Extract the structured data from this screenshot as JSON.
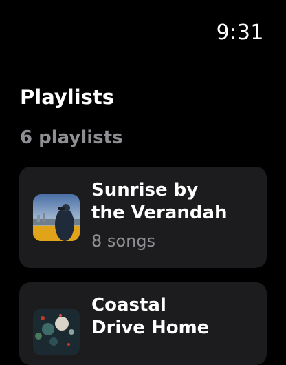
{
  "status_bar": {
    "time": "9:31"
  },
  "header": {
    "title": "Playlists",
    "count": "6 playlists"
  },
  "playlists": [
    {
      "title": "Sunrise by\nthe Verandah",
      "subtitle": "8 songs"
    },
    {
      "title": "Coastal\nDrive Home",
      "subtitle": ""
    }
  ],
  "colors": {
    "background": "#000000",
    "card": "#1c1c1e",
    "secondary_text": "#8e8e93"
  }
}
